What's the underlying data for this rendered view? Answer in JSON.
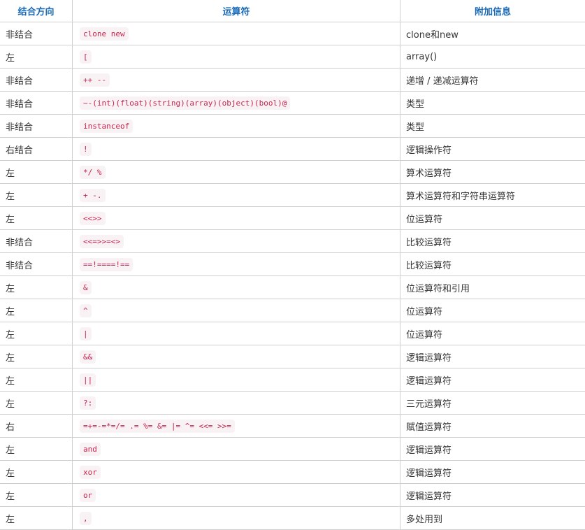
{
  "table": {
    "headers": {
      "associativity": "结合方向",
      "operator": "运算符",
      "info": "附加信息"
    },
    "rows": [
      {
        "assoc": "非结合",
        "op": "clone new",
        "info": "clone和new"
      },
      {
        "assoc": "左",
        "op": "[",
        "info": "array()"
      },
      {
        "assoc": "非结合",
        "op": "++ --",
        "info": "递增 / 递减运算符"
      },
      {
        "assoc": "非结合",
        "op": "~-(int)(float)(string)(array)(object)(bool)@",
        "info": "类型"
      },
      {
        "assoc": "非结合",
        "op": "instanceof",
        "info": "类型"
      },
      {
        "assoc": "右结合",
        "op": "!",
        "info": "逻辑操作符"
      },
      {
        "assoc": "左",
        "op": "*/ %",
        "info": "算术运算符"
      },
      {
        "assoc": "左",
        "op": "+ -.",
        "info": "算术运算符和字符串运算符"
      },
      {
        "assoc": "左",
        "op": "<<>>",
        "info": "位运算符"
      },
      {
        "assoc": "非结合",
        "op": "<<=>>=<>",
        "info": "比较运算符"
      },
      {
        "assoc": "非结合",
        "op": "==!====!==",
        "info": "比较运算符"
      },
      {
        "assoc": "左",
        "op": "&",
        "info": "位运算符和引用"
      },
      {
        "assoc": "左",
        "op": "^",
        "info": "位运算符"
      },
      {
        "assoc": "左",
        "op": "|",
        "info": "位运算符"
      },
      {
        "assoc": "左",
        "op": "&&",
        "info": "逻辑运算符"
      },
      {
        "assoc": "左",
        "op": "||",
        "info": "逻辑运算符"
      },
      {
        "assoc": "左",
        "op": "?:",
        "info": "三元运算符"
      },
      {
        "assoc": "右",
        "op": "=+=-=*=/= .= %= &= |= ^= <<= >>=",
        "info": "赋值运算符"
      },
      {
        "assoc": "左",
        "op": "and",
        "info": "逻辑运算符"
      },
      {
        "assoc": "左",
        "op": "xor",
        "info": "逻辑运算符"
      },
      {
        "assoc": "左",
        "op": "or",
        "info": "逻辑运算符"
      },
      {
        "assoc": "左",
        "op": ",",
        "info": "多处用到"
      }
    ]
  },
  "colors": {
    "header_text": "#1a6ab5",
    "code_text": "#c7254e",
    "code_bg": "#f9f2f4",
    "border": "#cfcfcf",
    "body_text": "#333333"
  }
}
